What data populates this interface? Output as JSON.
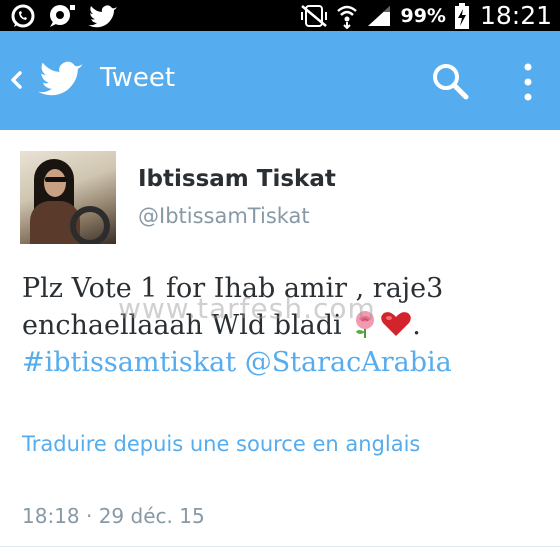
{
  "status_bar": {
    "battery_percent": "99%",
    "time": "18:21",
    "icons": [
      "whatsapp-icon",
      "chat-icon",
      "twitter-icon",
      "silent-icon",
      "wifi-icon",
      "signal-icon",
      "battery-charging-icon"
    ]
  },
  "app_bar": {
    "title": "Tweet",
    "color": "#55acee"
  },
  "tweet": {
    "display_name": "Ibtissam Tiskat",
    "handle": "@IbtissamTiskat",
    "text_line1": "Plz Vote 1 for Ihab amir , raje3",
    "text_line2": "enchaellaaah Wld bladi",
    "text_period": ".",
    "hashtag": "#ibtissamtiskat",
    "mention": "@StaracArabia",
    "translate_label": "Traduire depuis une source en anglais",
    "timestamp": "18:18 · 29 déc. 15"
  },
  "watermark": "www.tarfesh.com",
  "colors": {
    "link": "#55acee",
    "text": "#292f33",
    "secondary": "#8899a6"
  }
}
